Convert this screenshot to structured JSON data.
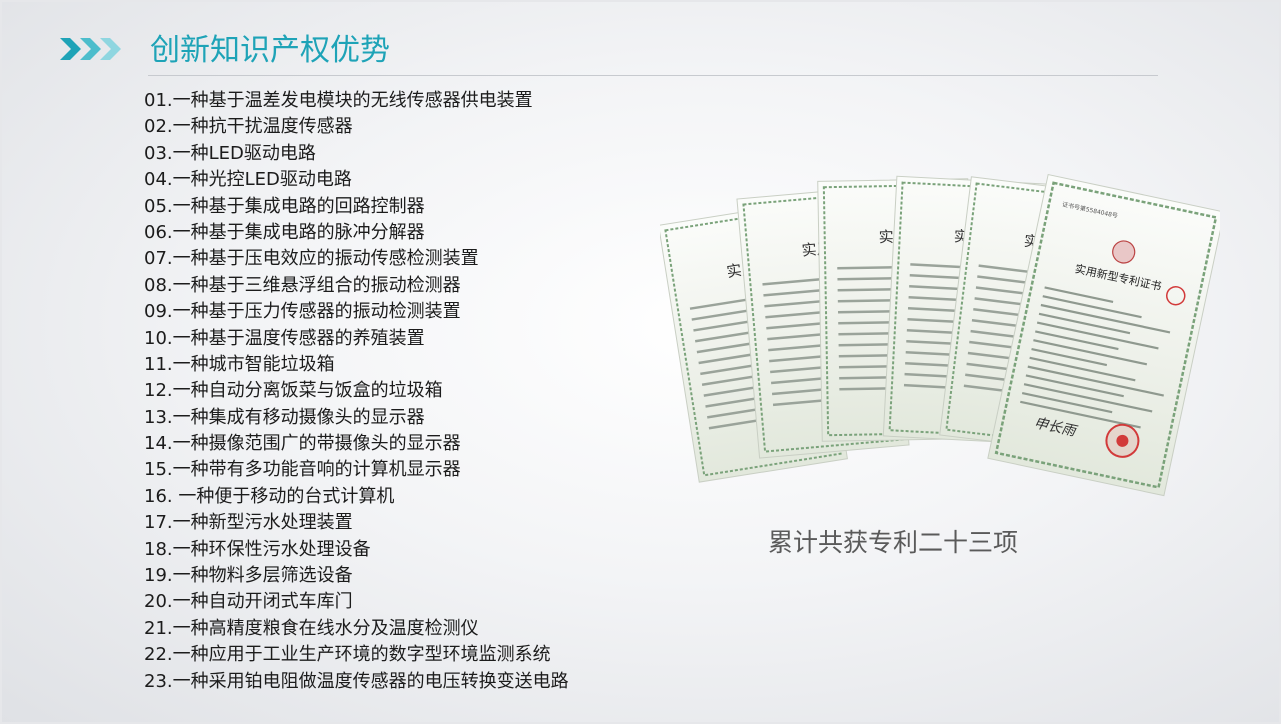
{
  "slide": {
    "title": "创新知识产权优势",
    "summary": "累计共获专利二十三项"
  },
  "patents": [
    "01.一种基于温差发电模块的无线传感器供电装置",
    "02.一种抗干扰温度传感器",
    "03.一种LED驱动电路",
    "04.一种光控LED驱动电路",
    "05.一种基于集成电路的回路控制器",
    "06.一种基于集成电路的脉冲分解器",
    "07.一种基于压电效应的振动传感检测装置",
    "08.一种基于三维悬浮组合的振动检测器",
    "09.一种基于压力传感器的振动检测装置",
    "10.一种基于温度传感器的养殖装置",
    "11.一种城市智能垃圾箱",
    "12.一种自动分离饭菜与饭盒的垃圾箱",
    "13.一种集成有移动摄像头的显示器",
    "14.一种摄像范围广的带摄像头的显示器",
    "15.一种带有多功能音响的计算机显示器",
    "16. 一种便于移动的台式计算机",
    "17.一种新型污水处理装置",
    "18.一种环保性污水处理设备",
    "19.一种物料多层筛选设备",
    "20.一种自动开闭式车库门",
    "21.一种高精度粮食在线水分及温度检测仪",
    "22.一种应用于工业生产环境的数字型环境监测系统",
    "23.一种采用铂电阻做温度传感器的电压转换变送电路"
  ],
  "certificate": {
    "heading": "实用新型专利证书",
    "heading_short": "实用",
    "number_line": "证书号第5584048号",
    "signature": "申长雨"
  },
  "colors": {
    "accent": "#1ea3b7",
    "text": "#1c1c1c",
    "summary": "#5a5a5a",
    "rule": "#c7cacf",
    "seal": "#d23a3a",
    "cert_border": "#7aa27a"
  },
  "icons": {
    "title_marker": "triple-chevron-right-icon"
  }
}
